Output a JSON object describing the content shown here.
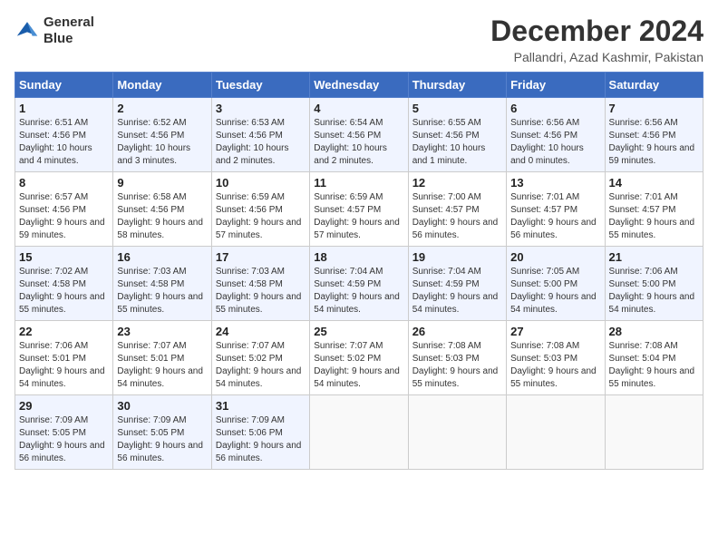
{
  "logo": {
    "line1": "General",
    "line2": "Blue"
  },
  "title": "December 2024",
  "location": "Pallandri, Azad Kashmir, Pakistan",
  "columns": [
    "Sunday",
    "Monday",
    "Tuesday",
    "Wednesday",
    "Thursday",
    "Friday",
    "Saturday"
  ],
  "weeks": [
    [
      {
        "day": "1",
        "sunrise": "Sunrise: 6:51 AM",
        "sunset": "Sunset: 4:56 PM",
        "daylight": "Daylight: 10 hours and 4 minutes."
      },
      {
        "day": "2",
        "sunrise": "Sunrise: 6:52 AM",
        "sunset": "Sunset: 4:56 PM",
        "daylight": "Daylight: 10 hours and 3 minutes."
      },
      {
        "day": "3",
        "sunrise": "Sunrise: 6:53 AM",
        "sunset": "Sunset: 4:56 PM",
        "daylight": "Daylight: 10 hours and 2 minutes."
      },
      {
        "day": "4",
        "sunrise": "Sunrise: 6:54 AM",
        "sunset": "Sunset: 4:56 PM",
        "daylight": "Daylight: 10 hours and 2 minutes."
      },
      {
        "day": "5",
        "sunrise": "Sunrise: 6:55 AM",
        "sunset": "Sunset: 4:56 PM",
        "daylight": "Daylight: 10 hours and 1 minute."
      },
      {
        "day": "6",
        "sunrise": "Sunrise: 6:56 AM",
        "sunset": "Sunset: 4:56 PM",
        "daylight": "Daylight: 10 hours and 0 minutes."
      },
      {
        "day": "7",
        "sunrise": "Sunrise: 6:56 AM",
        "sunset": "Sunset: 4:56 PM",
        "daylight": "Daylight: 9 hours and 59 minutes."
      }
    ],
    [
      {
        "day": "8",
        "sunrise": "Sunrise: 6:57 AM",
        "sunset": "Sunset: 4:56 PM",
        "daylight": "Daylight: 9 hours and 59 minutes."
      },
      {
        "day": "9",
        "sunrise": "Sunrise: 6:58 AM",
        "sunset": "Sunset: 4:56 PM",
        "daylight": "Daylight: 9 hours and 58 minutes."
      },
      {
        "day": "10",
        "sunrise": "Sunrise: 6:59 AM",
        "sunset": "Sunset: 4:56 PM",
        "daylight": "Daylight: 9 hours and 57 minutes."
      },
      {
        "day": "11",
        "sunrise": "Sunrise: 6:59 AM",
        "sunset": "Sunset: 4:57 PM",
        "daylight": "Daylight: 9 hours and 57 minutes."
      },
      {
        "day": "12",
        "sunrise": "Sunrise: 7:00 AM",
        "sunset": "Sunset: 4:57 PM",
        "daylight": "Daylight: 9 hours and 56 minutes."
      },
      {
        "day": "13",
        "sunrise": "Sunrise: 7:01 AM",
        "sunset": "Sunset: 4:57 PM",
        "daylight": "Daylight: 9 hours and 56 minutes."
      },
      {
        "day": "14",
        "sunrise": "Sunrise: 7:01 AM",
        "sunset": "Sunset: 4:57 PM",
        "daylight": "Daylight: 9 hours and 55 minutes."
      }
    ],
    [
      {
        "day": "15",
        "sunrise": "Sunrise: 7:02 AM",
        "sunset": "Sunset: 4:58 PM",
        "daylight": "Daylight: 9 hours and 55 minutes."
      },
      {
        "day": "16",
        "sunrise": "Sunrise: 7:03 AM",
        "sunset": "Sunset: 4:58 PM",
        "daylight": "Daylight: 9 hours and 55 minutes."
      },
      {
        "day": "17",
        "sunrise": "Sunrise: 7:03 AM",
        "sunset": "Sunset: 4:58 PM",
        "daylight": "Daylight: 9 hours and 55 minutes."
      },
      {
        "day": "18",
        "sunrise": "Sunrise: 7:04 AM",
        "sunset": "Sunset: 4:59 PM",
        "daylight": "Daylight: 9 hours and 54 minutes."
      },
      {
        "day": "19",
        "sunrise": "Sunrise: 7:04 AM",
        "sunset": "Sunset: 4:59 PM",
        "daylight": "Daylight: 9 hours and 54 minutes."
      },
      {
        "day": "20",
        "sunrise": "Sunrise: 7:05 AM",
        "sunset": "Sunset: 5:00 PM",
        "daylight": "Daylight: 9 hours and 54 minutes."
      },
      {
        "day": "21",
        "sunrise": "Sunrise: 7:06 AM",
        "sunset": "Sunset: 5:00 PM",
        "daylight": "Daylight: 9 hours and 54 minutes."
      }
    ],
    [
      {
        "day": "22",
        "sunrise": "Sunrise: 7:06 AM",
        "sunset": "Sunset: 5:01 PM",
        "daylight": "Daylight: 9 hours and 54 minutes."
      },
      {
        "day": "23",
        "sunrise": "Sunrise: 7:07 AM",
        "sunset": "Sunset: 5:01 PM",
        "daylight": "Daylight: 9 hours and 54 minutes."
      },
      {
        "day": "24",
        "sunrise": "Sunrise: 7:07 AM",
        "sunset": "Sunset: 5:02 PM",
        "daylight": "Daylight: 9 hours and 54 minutes."
      },
      {
        "day": "25",
        "sunrise": "Sunrise: 7:07 AM",
        "sunset": "Sunset: 5:02 PM",
        "daylight": "Daylight: 9 hours and 54 minutes."
      },
      {
        "day": "26",
        "sunrise": "Sunrise: 7:08 AM",
        "sunset": "Sunset: 5:03 PM",
        "daylight": "Daylight: 9 hours and 55 minutes."
      },
      {
        "day": "27",
        "sunrise": "Sunrise: 7:08 AM",
        "sunset": "Sunset: 5:03 PM",
        "daylight": "Daylight: 9 hours and 55 minutes."
      },
      {
        "day": "28",
        "sunrise": "Sunrise: 7:08 AM",
        "sunset": "Sunset: 5:04 PM",
        "daylight": "Daylight: 9 hours and 55 minutes."
      }
    ],
    [
      {
        "day": "29",
        "sunrise": "Sunrise: 7:09 AM",
        "sunset": "Sunset: 5:05 PM",
        "daylight": "Daylight: 9 hours and 56 minutes."
      },
      {
        "day": "30",
        "sunrise": "Sunrise: 7:09 AM",
        "sunset": "Sunset: 5:05 PM",
        "daylight": "Daylight: 9 hours and 56 minutes."
      },
      {
        "day": "31",
        "sunrise": "Sunrise: 7:09 AM",
        "sunset": "Sunset: 5:06 PM",
        "daylight": "Daylight: 9 hours and 56 minutes."
      },
      null,
      null,
      null,
      null
    ]
  ]
}
